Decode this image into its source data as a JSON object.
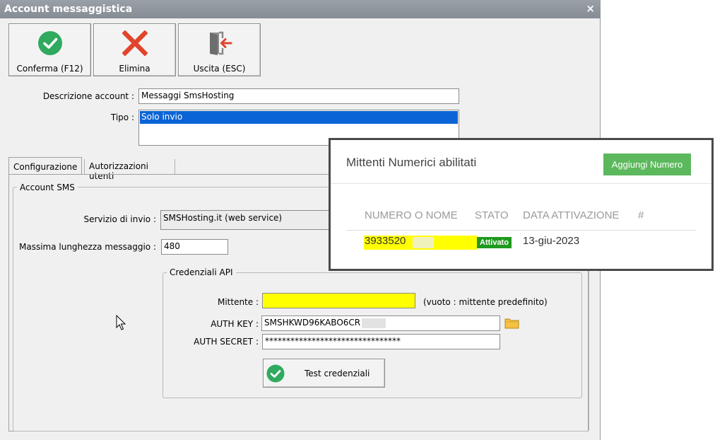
{
  "window": {
    "title": "Account messaggistica",
    "close_glyph": "×"
  },
  "toolbar": [
    {
      "label": "Conferma (F12)",
      "icon": "check-circle-icon",
      "color": "#2faa5e"
    },
    {
      "label": "Elimina",
      "icon": "x-icon",
      "color": "#e0452c"
    },
    {
      "label": "Uscita (ESC)",
      "icon": "exit-door-icon",
      "color": "#e0452c"
    }
  ],
  "form": {
    "descrizione_label": "Descrizione account :",
    "descrizione_value": "Messaggi SmsHosting",
    "tipo_label": "Tipo :",
    "tipo_options": [
      "Solo invio"
    ],
    "tipo_selected_color": "#0a64d6"
  },
  "tabs": [
    {
      "label": "Configurazione",
      "active": true
    },
    {
      "label": "Autorizzazioni utenti",
      "active": false
    }
  ],
  "account_sms": {
    "group_title": "Account SMS",
    "servizio_label": "Servizio di invio :",
    "servizio_value": "SMSHosting.it (web service)",
    "massima_label": "Massima lunghezza messaggio :",
    "massima_value": "480"
  },
  "credenziali": {
    "group_title": "Credenziali API",
    "mittente_label": "Mittente :",
    "mittente_value": "",
    "mittente_note": "(vuoto : mittente predefinito)",
    "authkey_label": "AUTH KEY :",
    "authkey_value": "SMSHKWD96KABO6CR",
    "authsecret_label": "AUTH SECRET :",
    "authsecret_value": "********************************",
    "test_button": "Test credenziali",
    "highlight_color": "#ffff00"
  },
  "popup": {
    "title": "Mittenti Numerici abilitati",
    "add_button": "Aggiungi Numero",
    "columns": [
      "NUMERO O NOME",
      "STATO",
      "DATA ATTIVAZIONE",
      "#"
    ],
    "rows": [
      {
        "numero": "3933520",
        "stato": "Attivato",
        "data": "13-giu-2023"
      }
    ],
    "accent_color": "#5cb85c"
  }
}
